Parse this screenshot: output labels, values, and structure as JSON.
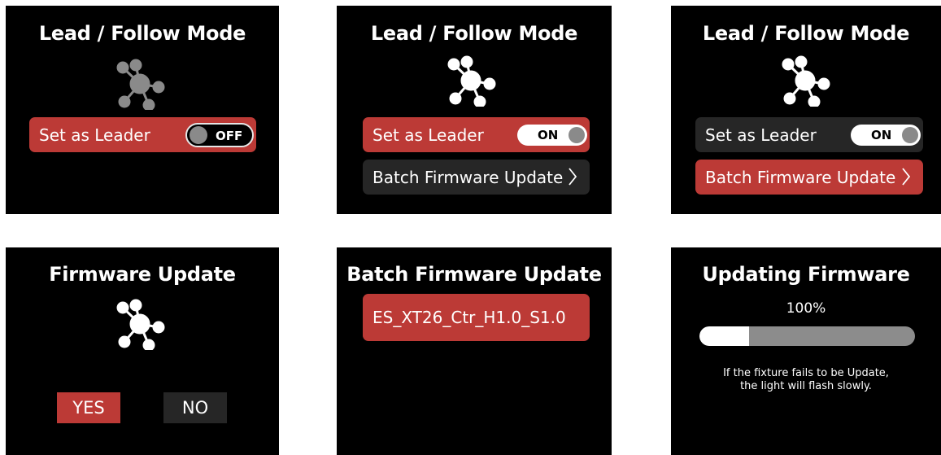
{
  "panels": [
    {
      "title": "Lead / Follow Mode",
      "leader_label": "Set as Leader",
      "toggle_text": "OFF"
    },
    {
      "title": "Lead / Follow Mode",
      "leader_label": "Set as Leader",
      "toggle_text": "ON",
      "batch_label": "Batch Firmware Update"
    },
    {
      "title": "Lead / Follow Mode",
      "leader_label": "Set as Leader",
      "toggle_text": "ON",
      "batch_label": "Batch Firmware Update"
    },
    {
      "title": "Firmware Update",
      "yes_label": "YES",
      "no_label": "NO"
    },
    {
      "title": "Batch Firmware Update",
      "file_label": "ES_XT26_Ctr_H1.0_S1.0"
    },
    {
      "title": "Updating Firmware",
      "percent_text": "100%",
      "progress_fill": 0.23,
      "note": "If the fixture fails to be Update,\nthe light will flash slowly."
    }
  ],
  "colors": {
    "accent_red": "#bc3a36",
    "row_dark": "#262626",
    "icon_gray": "#8a8a8a",
    "icon_white": "#ffffff"
  },
  "icons": {
    "network": "network-hub-icon",
    "chevron": "chevron-right-icon"
  }
}
